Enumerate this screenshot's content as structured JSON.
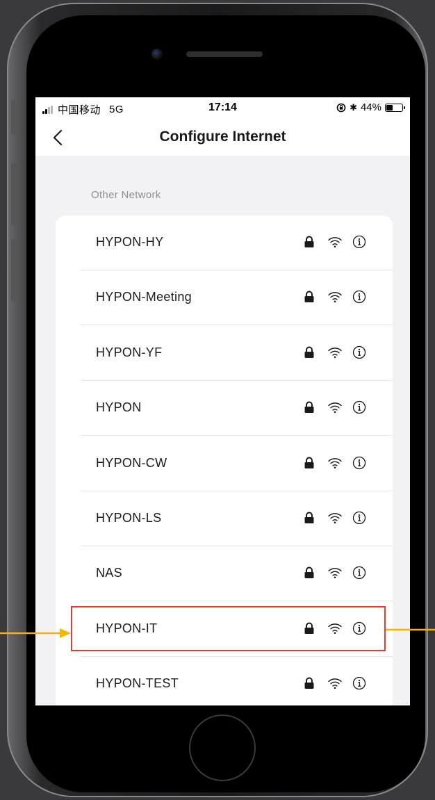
{
  "status_bar": {
    "carrier": "中国移动",
    "network_type": "5G",
    "time": "17:14",
    "bluetooth_symbol": "✱",
    "battery_percent": "44%",
    "battery_level": 0.44
  },
  "nav": {
    "title": "Configure Internet",
    "back_icon": "chevron-left-icon"
  },
  "section": {
    "title": "Other Network"
  },
  "networks": [
    {
      "name": "HYPON-HY"
    },
    {
      "name": "HYPON-Meeting"
    },
    {
      "name": "HYPON-YF"
    },
    {
      "name": "HYPON"
    },
    {
      "name": "HYPON-CW"
    },
    {
      "name": "HYPON-LS"
    },
    {
      "name": "NAS"
    },
    {
      "name": "HYPON-IT"
    },
    {
      "name": "HYPON-TEST"
    }
  ],
  "row_icons": [
    "lock-icon",
    "wifi-icon",
    "info-icon"
  ],
  "highlighted_network": "HYPON-IT",
  "colors": {
    "highlight_border": "#e53935",
    "annotation_arrow": "#f5b400",
    "screen_background": "#f2f2f4"
  }
}
